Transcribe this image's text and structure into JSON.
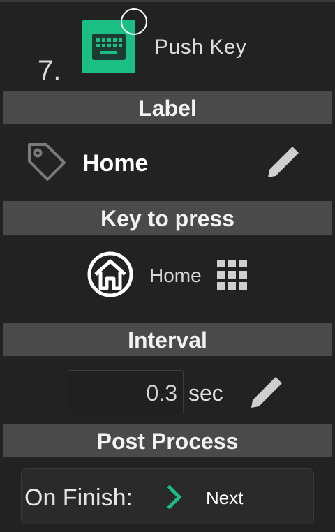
{
  "step": {
    "number": "7.",
    "title": "Push Key",
    "icon": "keyboard-icon"
  },
  "sections": {
    "label": "Label",
    "key_to_press": "Key to press",
    "interval": "Interval",
    "post_process": "Post Process"
  },
  "label": {
    "value": "Home",
    "icon": "tag-icon",
    "edit_icon": "pencil-icon"
  },
  "key": {
    "name": "Home",
    "icon": "home-circle-icon",
    "picker_icon": "grid-icon"
  },
  "interval": {
    "value": "0.3",
    "unit": "sec",
    "edit_icon": "pencil-icon"
  },
  "post_process": {
    "on_finish_label": "On Finish:",
    "on_finish_value": "Next",
    "chevron_icon": "chevron-right-icon"
  },
  "colors": {
    "background": "#222222",
    "header": "#4a4a4a",
    "accent": "#1bbf83"
  }
}
